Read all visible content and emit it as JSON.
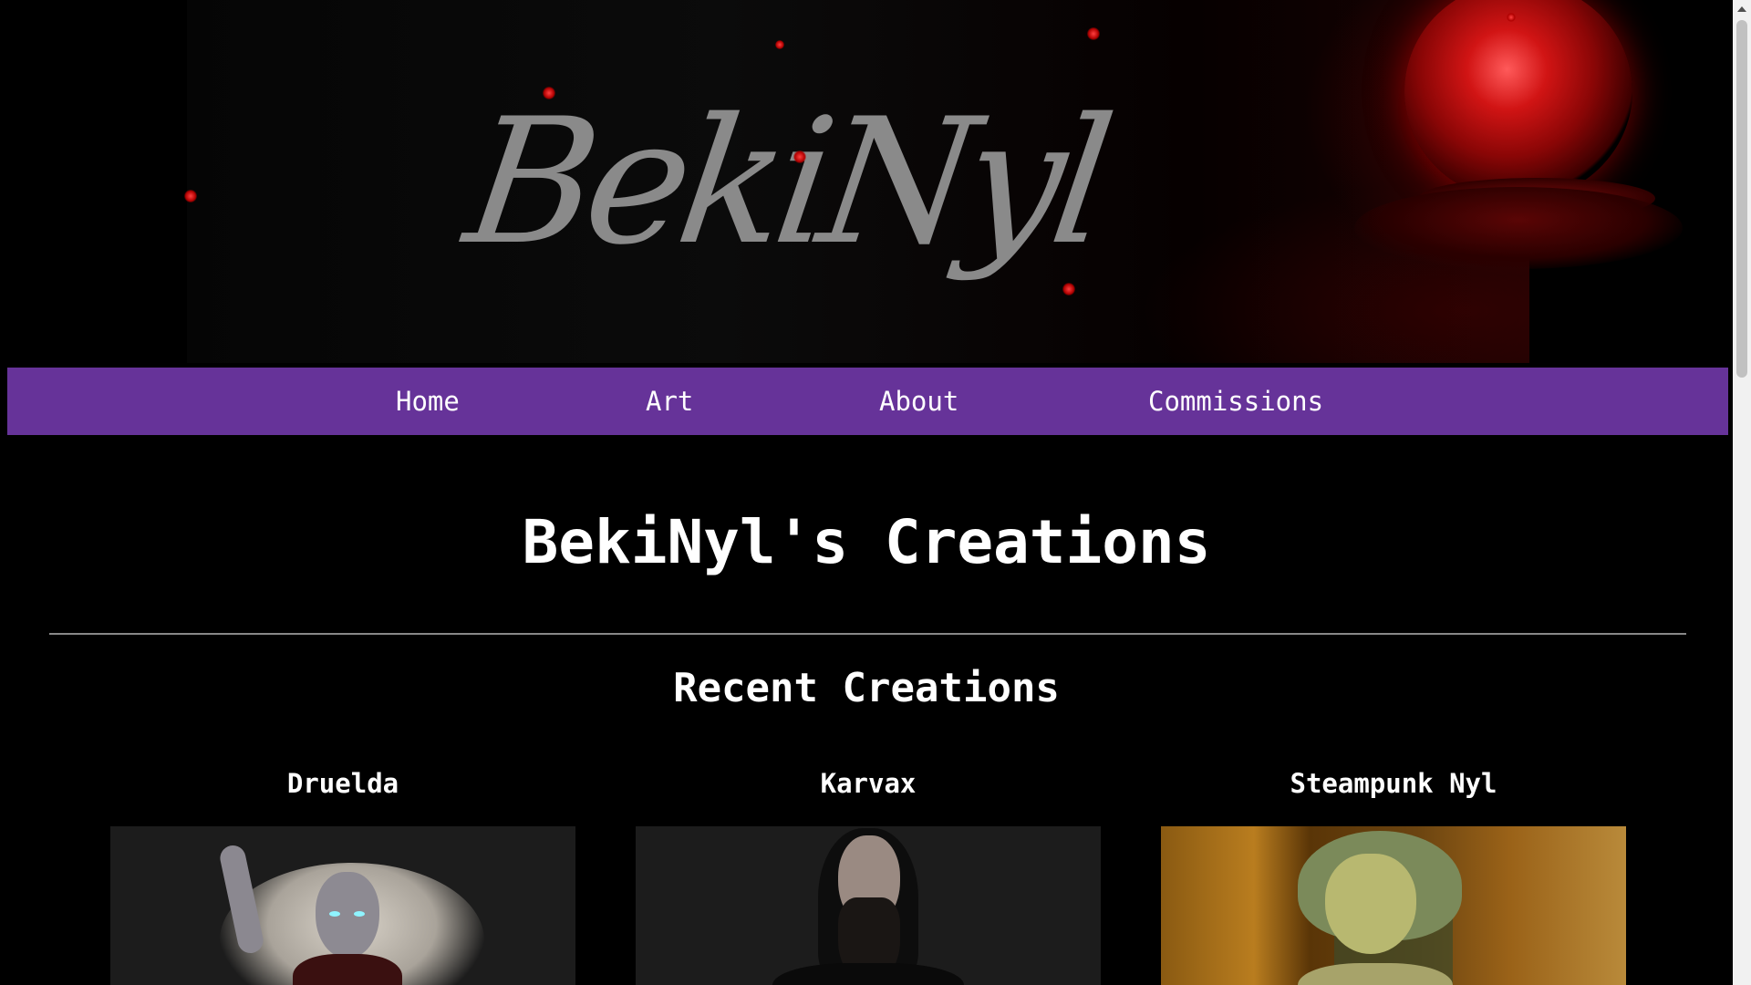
{
  "banner": {
    "logo_text": "BekiNyl"
  },
  "nav": {
    "items": [
      {
        "label": "Home"
      },
      {
        "label": "Art"
      },
      {
        "label": "About"
      },
      {
        "label": "Commissions"
      }
    ],
    "background_color": "#663399"
  },
  "main": {
    "title": "BekiNyl's Creations",
    "section_title": "Recent Creations",
    "creations": [
      {
        "title": "Druelda"
      },
      {
        "title": "Karvax"
      },
      {
        "title": "Steampunk Nyl"
      }
    ]
  }
}
